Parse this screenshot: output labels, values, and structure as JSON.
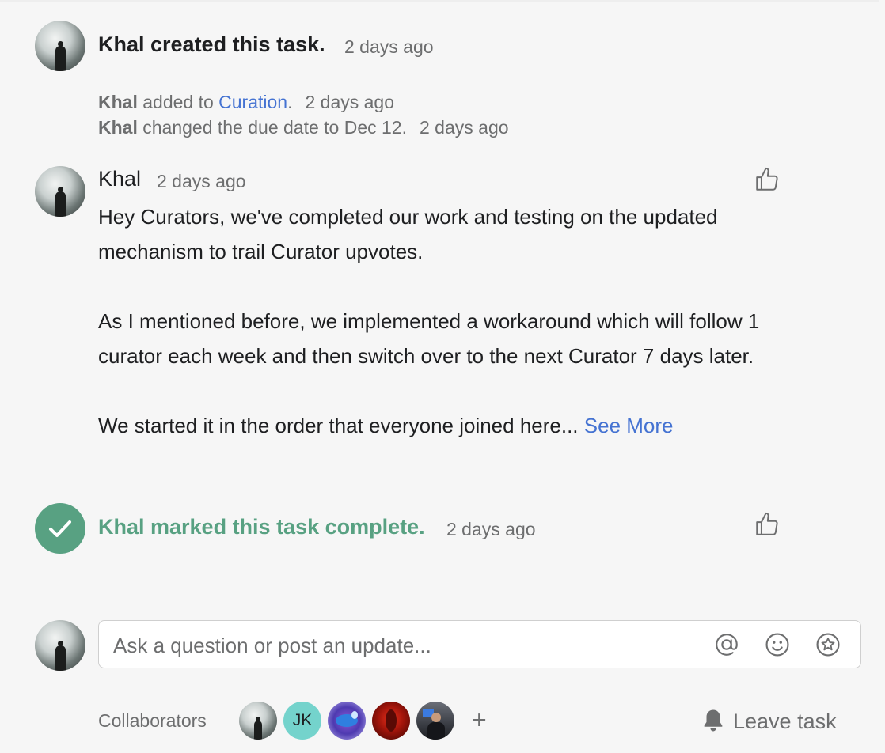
{
  "created": {
    "actor_action": "Khal created this task.",
    "time": "2 days ago"
  },
  "activities": [
    {
      "actor": "Khal",
      "pre": " added to ",
      "link": "Curation",
      "post": ".",
      "time": "2 days ago"
    },
    {
      "actor": "Khal",
      "pre": " changed the due date to Dec 12.",
      "link": "",
      "post": "",
      "time": "2 days ago"
    }
  ],
  "comment": {
    "author": "Khal",
    "time": "2 days ago",
    "paragraph1": "Hey Curators, we've completed our work and testing on the updated mechanism to trail Curator upvotes.",
    "paragraph2": "As I mentioned before, we implemented a workaround which will follow 1 curator each week and then switch over to the next Curator 7 days later.",
    "paragraph3": "We started it in the order that everyone joined here...",
    "see_more": "See More"
  },
  "completed": {
    "text": "Khal marked this task complete.",
    "time": "2 days ago"
  },
  "composer": {
    "placeholder": "Ask a question or post an update..."
  },
  "collaborators": {
    "label": "Collaborators",
    "initials": "JK",
    "add": "+"
  },
  "leave_task_label": "Leave task",
  "colors": {
    "link": "#4573d2",
    "complete": "#58a182",
    "muted": "#6d6e6f",
    "collab_teal": "#74d3cc"
  }
}
